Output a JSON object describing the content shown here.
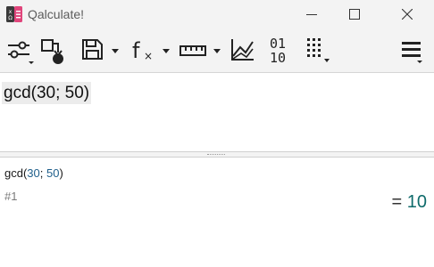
{
  "window": {
    "title": "Qalculate!"
  },
  "colors": {
    "accent_teal": "#0f6b6b",
    "number_blue": "#1f5f8b",
    "chrome_bg": "#f3f3f3"
  },
  "toolbar": {
    "items": [
      {
        "icon": "mode-settings-icon"
      },
      {
        "icon": "convert-to-icon"
      },
      {
        "icon": "save-icon"
      },
      {
        "icon": "functions-icon"
      },
      {
        "icon": "units-icon"
      },
      {
        "icon": "plot-icon"
      },
      {
        "icon": "number-bases-icon"
      },
      {
        "icon": "keypad-icon"
      },
      {
        "icon": "menu-icon"
      }
    ],
    "number_bases_top": "01",
    "number_bases_bottom": "10"
  },
  "expression": {
    "value": "gcd(30; 50)"
  },
  "history": {
    "expr_prefix": "gcd(",
    "arg1": "30",
    "separator": "; ",
    "arg2": "50",
    "expr_suffix": ")",
    "ref": "#1",
    "equals": "=",
    "result": "10"
  }
}
